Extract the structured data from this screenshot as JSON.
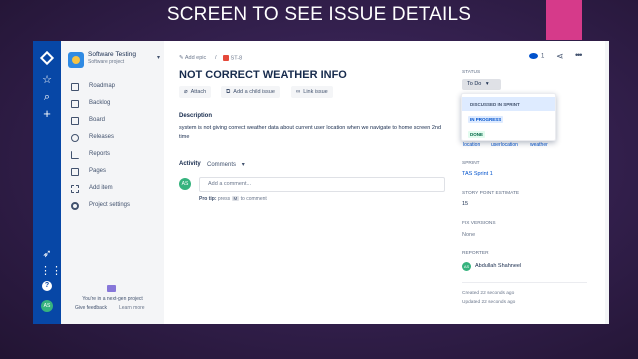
{
  "slide": {
    "title": "SCREEN TO SEE ISSUE DETAILS"
  },
  "project": {
    "name": "Software Testing",
    "type": "Software project",
    "nav": [
      {
        "label": "Roadmap",
        "icon": "roadmap-icon"
      },
      {
        "label": "Backlog",
        "icon": "backlog-icon"
      },
      {
        "label": "Board",
        "icon": "board-icon"
      },
      {
        "label": "Releases",
        "icon": "releases-icon"
      },
      {
        "label": "Reports",
        "icon": "reports-icon"
      },
      {
        "label": "Pages",
        "icon": "pages-icon"
      },
      {
        "label": "Add item",
        "icon": "add-item-icon"
      },
      {
        "label": "Project settings",
        "icon": "settings-icon"
      }
    ],
    "next_gen_note": "You're in a next-gen project",
    "give_feedback": "Give feedback",
    "learn_more": "Learn more"
  },
  "global_nav": {
    "avatar_initials": "AS",
    "icons": [
      "jira-logo-icon",
      "star-icon",
      "search-icon",
      "plus-icon",
      "rocket-icon",
      "apps-grid-icon",
      "help-icon"
    ]
  },
  "issue": {
    "breadcrumb": {
      "add_epic": "Add epic",
      "separator": "/",
      "key": "ST-8"
    },
    "title": "NOT CORRECT WEATHER INFO",
    "buttons": {
      "attach": "Attach",
      "add_child": "Add a child issue",
      "link": "Link issue"
    },
    "description_label": "Description",
    "description": "system is not giving correct weather data about current user location when we navigate to home screen 2nd time",
    "activity_label": "Activity",
    "comments_filter": "Comments",
    "comment_avatar": "AS",
    "comment_placeholder": "Add a comment...",
    "protip": {
      "prefix": "Pro tip:",
      "middle": "press",
      "key": "M",
      "suffix": "to comment"
    }
  },
  "header_actions": {
    "watchers": "1"
  },
  "details": {
    "status_label": "STATUS",
    "status_value": "To Do",
    "status_options": [
      {
        "label": "DISCUSSED IN SPRINT",
        "color": "#42526e",
        "bg": "#dfe1e6"
      },
      {
        "label": "IN PROGRESS",
        "color": "#0052cc",
        "bg": "#deebff"
      },
      {
        "label": "DONE",
        "color": "#006644",
        "bg": "#e3fcef"
      }
    ],
    "labels": [
      "location",
      "userlocation",
      "weather"
    ],
    "sprint_label": "SPRINT",
    "sprint_value": "TAS Sprint 1",
    "story_points_label": "STORY POINT ESTIMATE",
    "story_points_value": "15",
    "fix_versions_label": "FIX VERSIONS",
    "fix_versions_value": "None",
    "reporter_label": "REPORTER",
    "reporter_initials": "AS",
    "reporter_name": "Abdullah Shahneel",
    "created": "Created 22 seconds ago",
    "updated": "Updated 22 seconds ago"
  },
  "colors": {
    "nav": "#0747a6",
    "accent": "#d63a8a",
    "link": "#0052cc"
  }
}
